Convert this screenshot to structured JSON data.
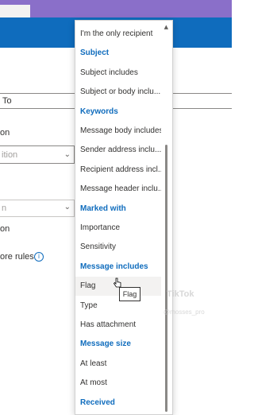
{
  "background": {
    "to_field_text": "To",
    "label_on": "on",
    "dropdown_placeholder": "ition",
    "select_value": "n",
    "label_on_2": "on",
    "more_rules": "ore rules",
    "info_glyph": "i"
  },
  "dropdown": {
    "scroll_up_glyph": "▲",
    "items": [
      {
        "label": "I'm the only recipient",
        "type": "option"
      },
      {
        "label": "Subject",
        "type": "header"
      },
      {
        "label": "Subject includes",
        "type": "option"
      },
      {
        "label": "Subject or body inclu...",
        "type": "option"
      },
      {
        "label": "Keywords",
        "type": "header"
      },
      {
        "label": "Message body includes",
        "type": "option"
      },
      {
        "label": "Sender address inclu...",
        "type": "option"
      },
      {
        "label": "Recipient address incl...",
        "type": "option"
      },
      {
        "label": "Message header inclu...",
        "type": "option"
      },
      {
        "label": "Marked with",
        "type": "header"
      },
      {
        "label": "Importance",
        "type": "option"
      },
      {
        "label": "Sensitivity",
        "type": "option"
      },
      {
        "label": "Message includes",
        "type": "header"
      },
      {
        "label": "Flag",
        "type": "option",
        "hover": true
      },
      {
        "label": "Type",
        "type": "option"
      },
      {
        "label": "Has attachment",
        "type": "option"
      },
      {
        "label": "Message size",
        "type": "header"
      },
      {
        "label": "At least",
        "type": "option"
      },
      {
        "label": "At most",
        "type": "option"
      },
      {
        "label": "Received",
        "type": "header"
      }
    ]
  },
  "tooltip": "Flag",
  "watermark": {
    "brand": "TikTok",
    "handle": "@mosses_pro"
  },
  "colors": {
    "accent": "#0f6cbd",
    "header_text": "#0f6cbd",
    "hover": "#f3f2f1",
    "top_strip": "#8a6fc9"
  }
}
